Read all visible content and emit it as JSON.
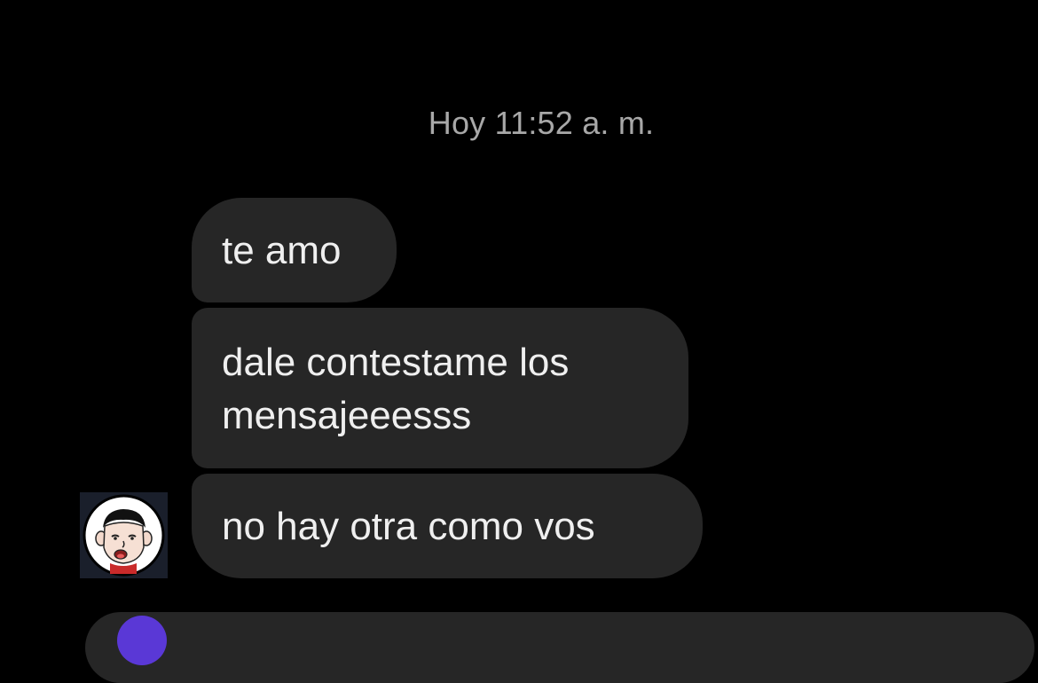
{
  "conversation": {
    "timestamp": "Hoy 11:52 a. m.",
    "messages": [
      {
        "text": "te amo"
      },
      {
        "text": "dale contestame los mensajeeesss"
      },
      {
        "text": "no hay otra como vos"
      }
    ]
  },
  "avatar": {
    "icon": "cartoon-boy-avatar"
  },
  "composer": {
    "icon": "camera-icon"
  },
  "colors": {
    "background": "#000000",
    "bubble": "#262626",
    "bubble_text": "#efefef",
    "timestamp_text": "#a8a8a8",
    "accent": "#5a38d6"
  }
}
